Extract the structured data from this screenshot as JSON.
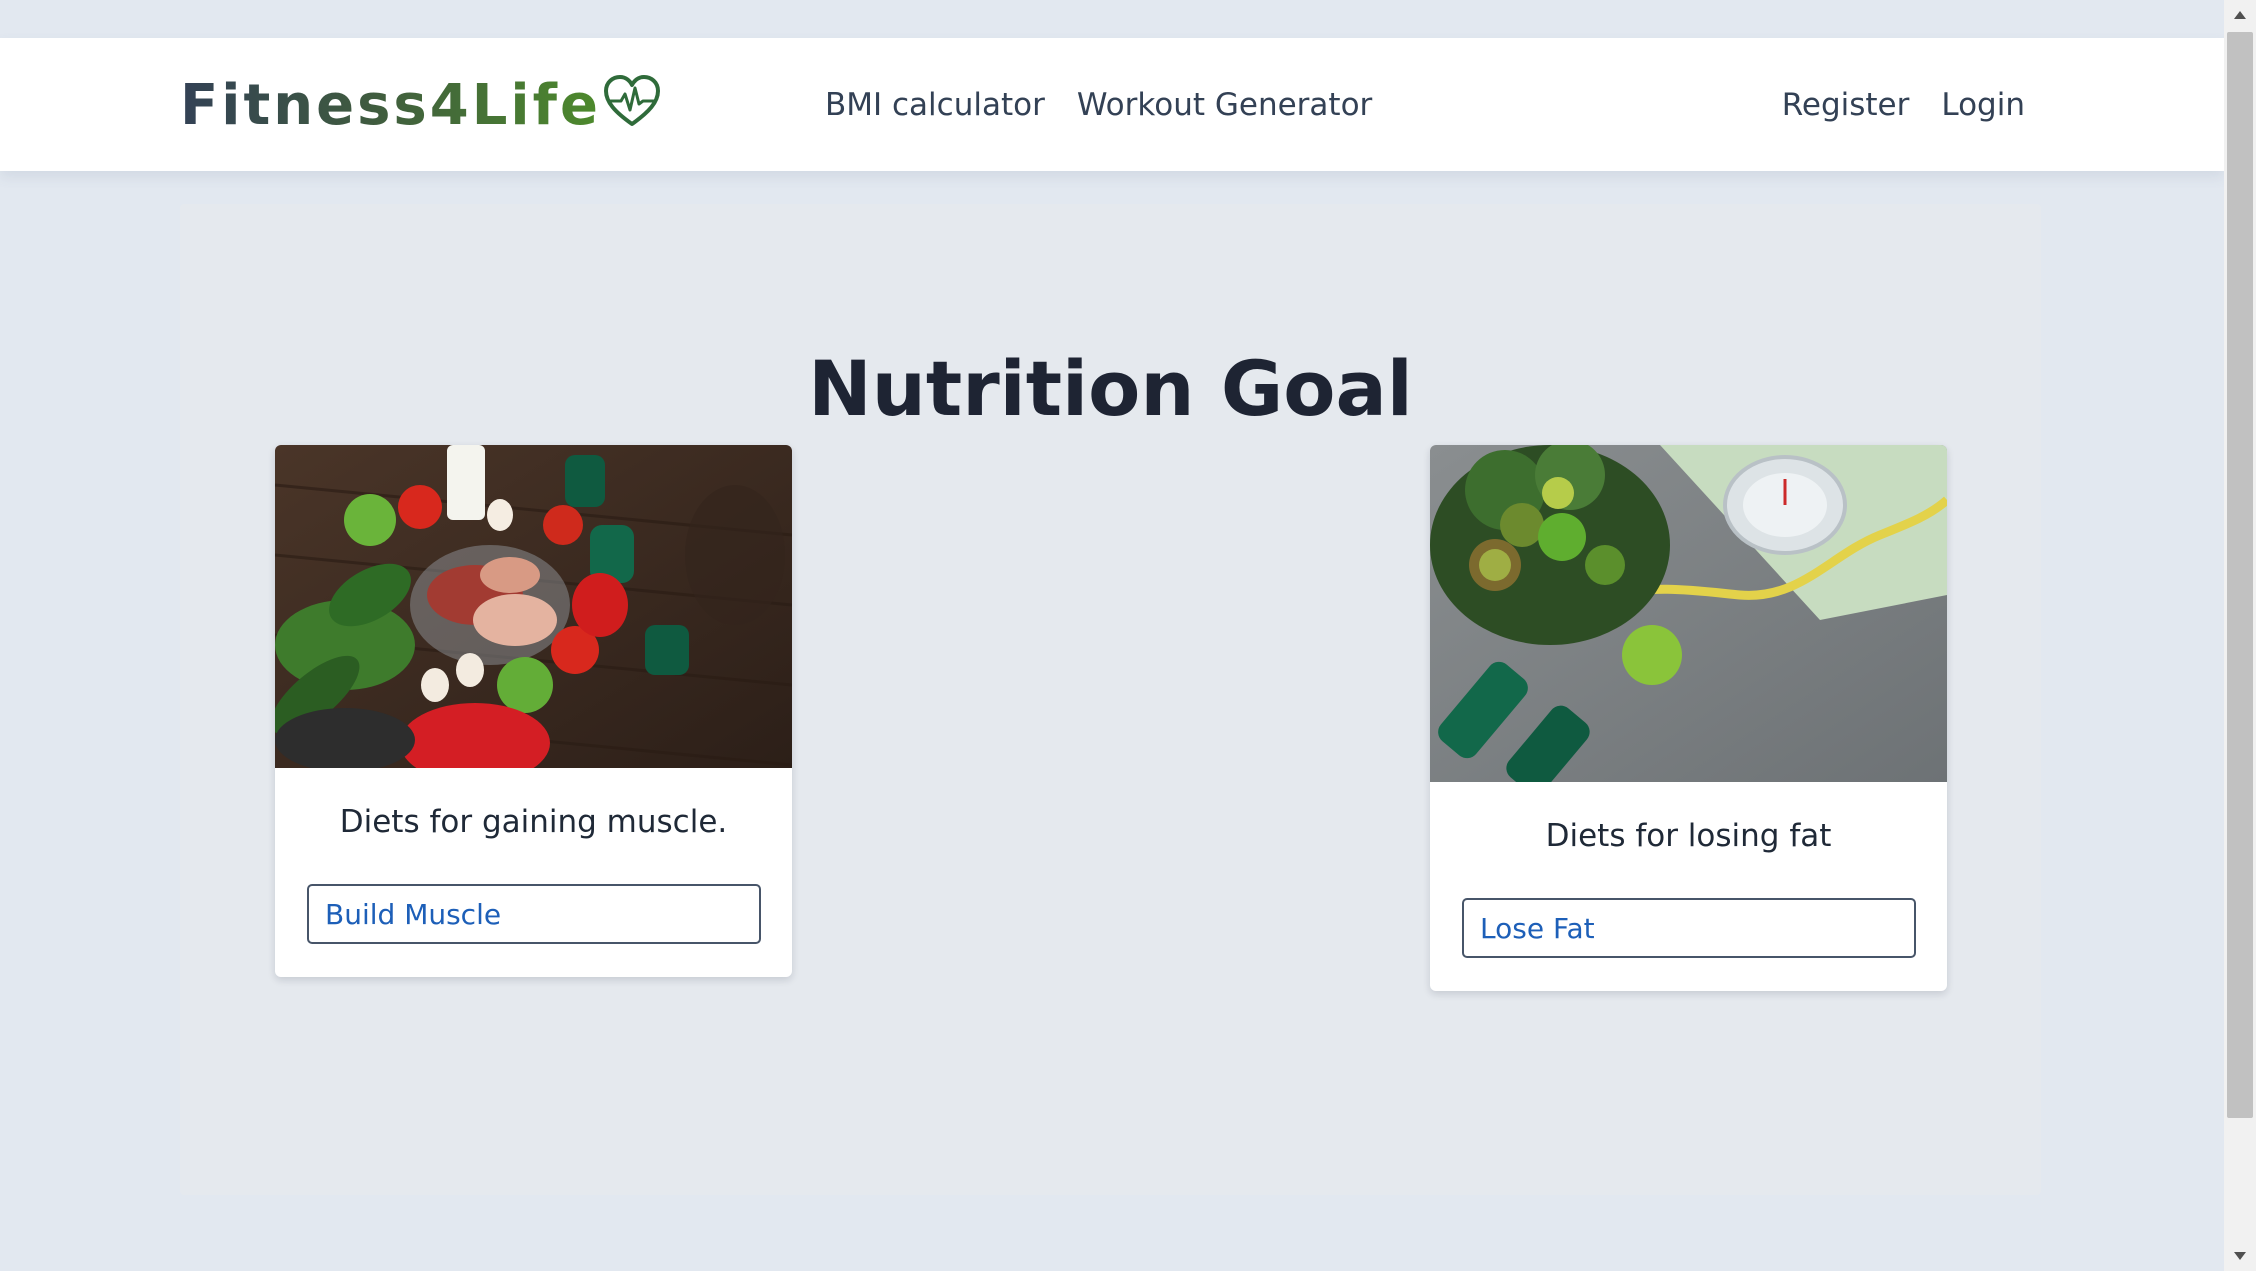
{
  "navbar": {
    "logo_text": "Fitness4Life",
    "links": [
      "BMI calculator",
      "Workout Generator"
    ],
    "auth": [
      "Register",
      "Login"
    ]
  },
  "main": {
    "title": "Nutrition Goal",
    "cards": [
      {
        "text": "Diets for gaining muscle.",
        "button_label": "Build Muscle"
      },
      {
        "text": "Diets for losing fat",
        "button_label": "Lose Fat"
      }
    ]
  },
  "colors": {
    "page_background": "#e2e8f0",
    "navbar_background": "#ffffff",
    "button_text": "#1d5fb8",
    "title_text": "#1e2433"
  },
  "icons": {
    "logo_heart": "heart-pulse-icon",
    "scroll_up": "chevron-up-icon",
    "scroll_down": "chevron-down-icon"
  }
}
